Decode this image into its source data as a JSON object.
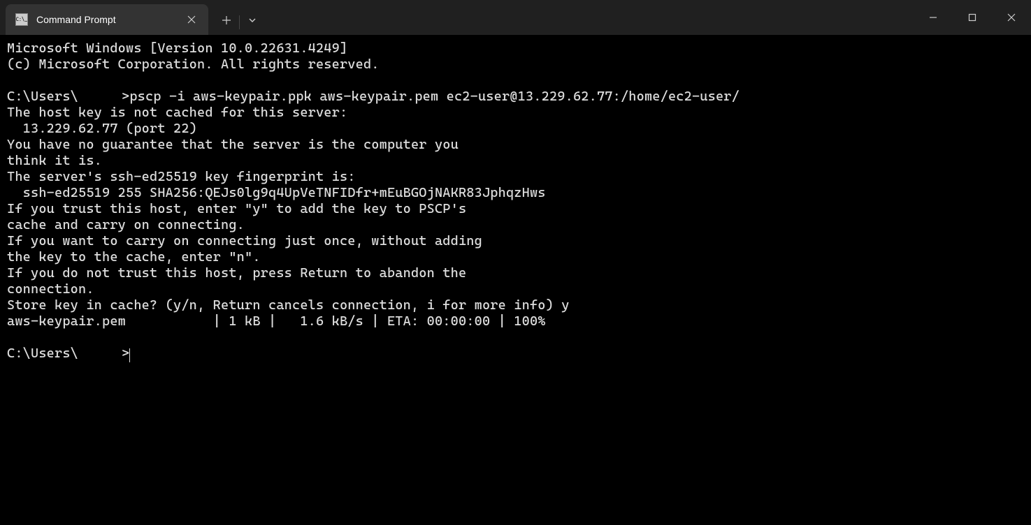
{
  "tab": {
    "title": "Command Prompt"
  },
  "terminal": {
    "l1": "Microsoft Windows [Version 10.0.22631.4249]",
    "l2": "(c) Microsoft Corporation. All rights reserved.",
    "l3": "",
    "prompt1_prefix": "C:\\Users\\",
    "prompt1_suffix": ">pscp -i aws-keypair.ppk aws-keypair.pem ec2-user@13.229.62.77:/home/ec2-user/",
    "l5": "The host key is not cached for this server:",
    "l6": "  13.229.62.77 (port 22)",
    "l7": "You have no guarantee that the server is the computer you",
    "l8": "think it is.",
    "l9": "The server's ssh-ed25519 key fingerprint is:",
    "l10": "  ssh-ed25519 255 SHA256:QEJs0lg9q4UpVeTNFIDfr+mEuBGOjNAKR83JphqzHws",
    "l11": "If you trust this host, enter \"y\" to add the key to PSCP's",
    "l12": "cache and carry on connecting.",
    "l13": "If you want to carry on connecting just once, without adding",
    "l14": "the key to the cache, enter \"n\".",
    "l15": "If you do not trust this host, press Return to abandon the",
    "l16": "connection.",
    "l17": "Store key in cache? (y/n, Return cancels connection, i for more info) y",
    "l18": "aws-keypair.pem           | 1 kB |   1.6 kB/s | ETA: 00:00:00 | 100%",
    "l19": "",
    "prompt2_prefix": "C:\\Users\\",
    "prompt2_suffix": ">"
  }
}
